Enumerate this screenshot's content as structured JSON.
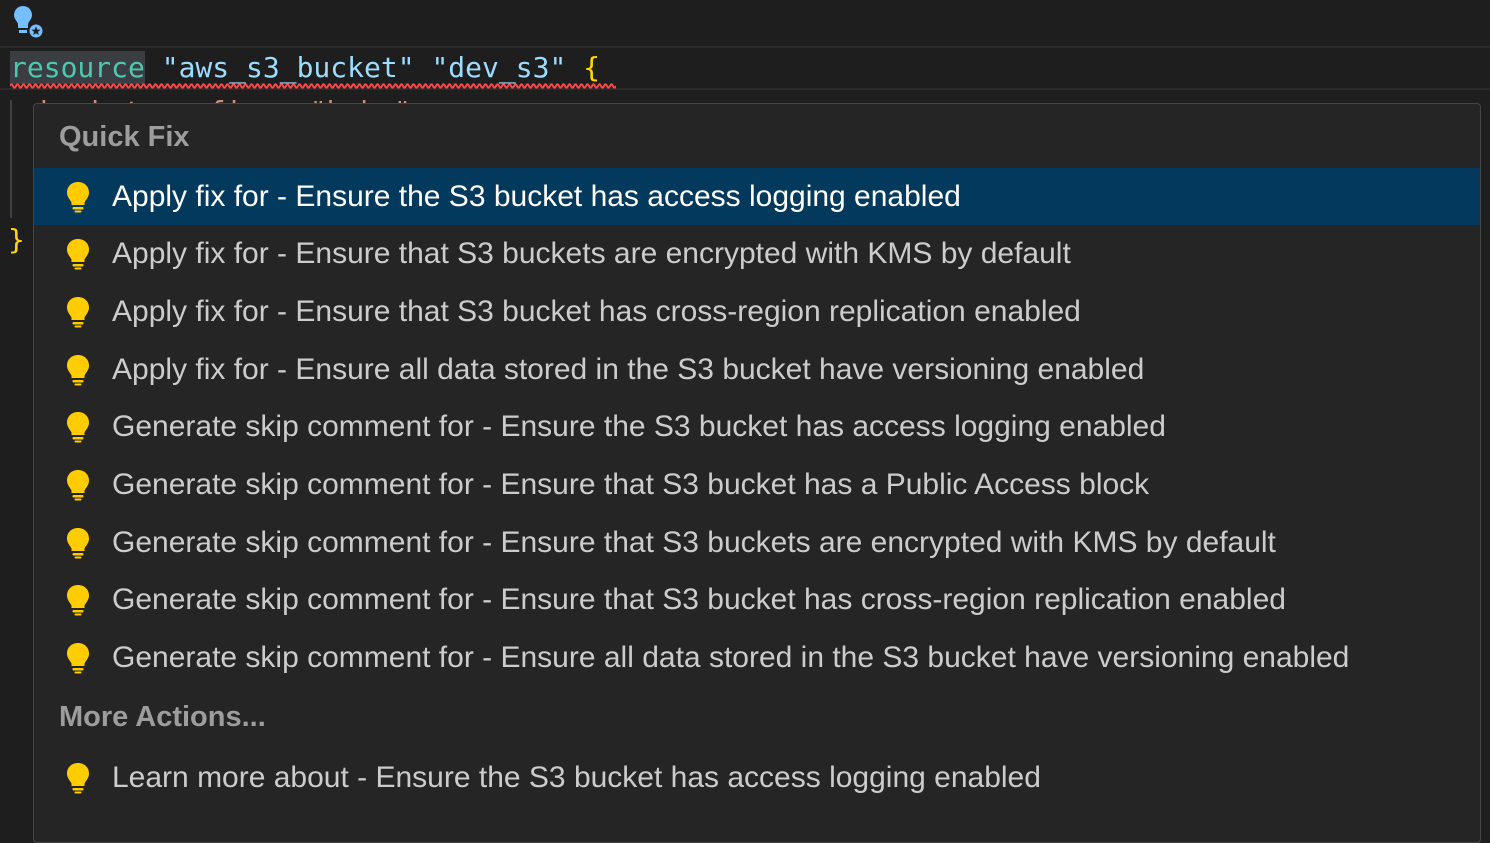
{
  "editor": {
    "code": {
      "keyword": "resource",
      "type_string": "\"aws_s3_bucket\"",
      "name_string": "\"dev_s3\"",
      "open_brace": "{",
      "partial_line": "bucket_prefix = \"bob-\"",
      "close_brace": "}"
    }
  },
  "quick_fix": {
    "header": "Quick Fix",
    "items": [
      {
        "label": "Apply fix for - Ensure the S3 bucket has access logging enabled",
        "selected": true
      },
      {
        "label": "Apply fix for - Ensure that S3 buckets are encrypted with KMS by default"
      },
      {
        "label": "Apply fix for - Ensure that S3 bucket has cross-region replication enabled"
      },
      {
        "label": "Apply fix for - Ensure all data stored in the S3 bucket have versioning enabled"
      },
      {
        "label": "Generate skip comment for - Ensure the S3 bucket has access logging enabled"
      },
      {
        "label": "Generate skip comment for - Ensure that S3 bucket has a Public Access block"
      },
      {
        "label": "Generate skip comment for - Ensure that S3 buckets are encrypted with KMS by default"
      },
      {
        "label": "Generate skip comment for - Ensure that S3 bucket has cross-region replication enabled"
      },
      {
        "label": "Generate skip comment for - Ensure all data stored in the S3 bucket have versioning enabled"
      }
    ],
    "more_header": "More Actions...",
    "more_items": [
      {
        "label": "Learn more about - Ensure the S3 bucket has access logging enabled"
      }
    ]
  },
  "colors": {
    "bulb": "#ffcc00",
    "selection": "#04395e",
    "keyword": "#4ec9b0",
    "string": "#9cdcfe",
    "error_squiggle": "#f14c4c"
  },
  "icons": {
    "gutter": "lightbulb-autofix-icon",
    "item": "lightbulb-icon"
  }
}
